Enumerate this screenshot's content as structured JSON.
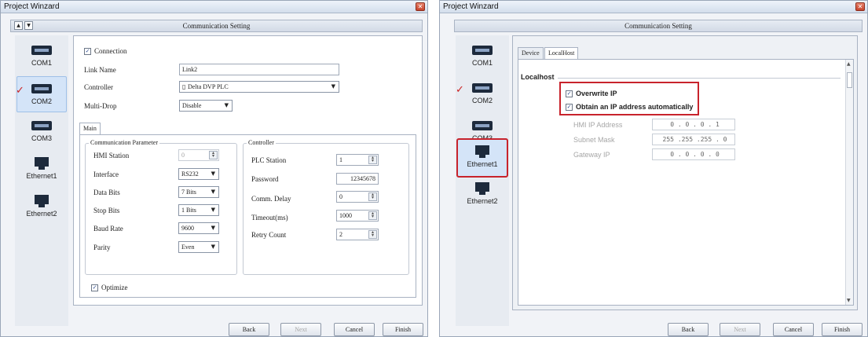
{
  "left": {
    "window_title": "Project Winzard",
    "header": "Communication Setting",
    "nav": {
      "up": "▲",
      "down": "▼"
    },
    "sidebar": [
      {
        "label": "COM1"
      },
      {
        "label": "COM2"
      },
      {
        "label": "COM3"
      },
      {
        "label": "Ethernet1"
      },
      {
        "label": "Ethernet2"
      }
    ],
    "connection_label": "Connection",
    "link_name_label": "Link Name",
    "link_name_value": "Link2",
    "controller_label": "Controller",
    "controller_value": "Delta DVP PLC",
    "multidrop_label": "Multi-Drop",
    "multidrop_value": "Disable",
    "tab_main": "Main",
    "comm_group_title": "Communication Parameter",
    "hmi_station_label": "HMI Station",
    "hmi_station_value": "0",
    "interface_label": "Interface",
    "interface_value": "RS232",
    "data_bits_label": "Data Bits",
    "data_bits_value": "7 Bits",
    "stop_bits_label": "Stop Bits",
    "stop_bits_value": "1 Bits",
    "baud_rate_label": "Baud Rate",
    "baud_rate_value": "9600",
    "parity_label": "Parity",
    "parity_value": "Even",
    "controller_group_title": "Controller",
    "plc_station_label": "PLC Station",
    "plc_station_value": "1",
    "password_label": "Password",
    "password_value": "12345678",
    "comm_delay_label": "Comm. Delay",
    "comm_delay_value": "0",
    "timeout_label": "Timeout(ms)",
    "timeout_value": "1000",
    "retry_label": "Retry Count",
    "retry_value": "2",
    "optimize_label": "Optimize",
    "buttons": {
      "back": "Back",
      "next": "Next",
      "cancel": "Cancel",
      "finish": "Finish"
    }
  },
  "right": {
    "window_title": "Project Winzard",
    "header": "Communication Setting",
    "sidebar": [
      {
        "label": "COM1"
      },
      {
        "label": "COM2"
      },
      {
        "label": "COM3"
      },
      {
        "label": "Ethernet1"
      },
      {
        "label": "Ethernet2"
      }
    ],
    "tabs": {
      "device": "Device",
      "localhost": "LocalHost"
    },
    "section_title": "Localhost",
    "overwrite_ip_label": "Overwrite IP",
    "obtain_ip_label": "Obtain an IP address automatically",
    "hmi_ip_label": "HMI IP Address",
    "hmi_ip_value": "0 . 0 . 0 . 1",
    "subnet_label": "Subnet Mask",
    "subnet_value": "255 .255 .255 . 0",
    "gateway_label": "Gateway IP",
    "gateway_value": "0 . 0 . 0 . 0",
    "buttons": {
      "back": "Back",
      "next": "Next",
      "cancel": "Cancel",
      "finish": "Finish"
    }
  },
  "icons": {
    "check": "✓",
    "close": "✕",
    "spin": "▲▼",
    "caret": "▼"
  },
  "colors": {
    "highlight_red": "#c8232c",
    "selected_bg": "#d4e4f8"
  }
}
